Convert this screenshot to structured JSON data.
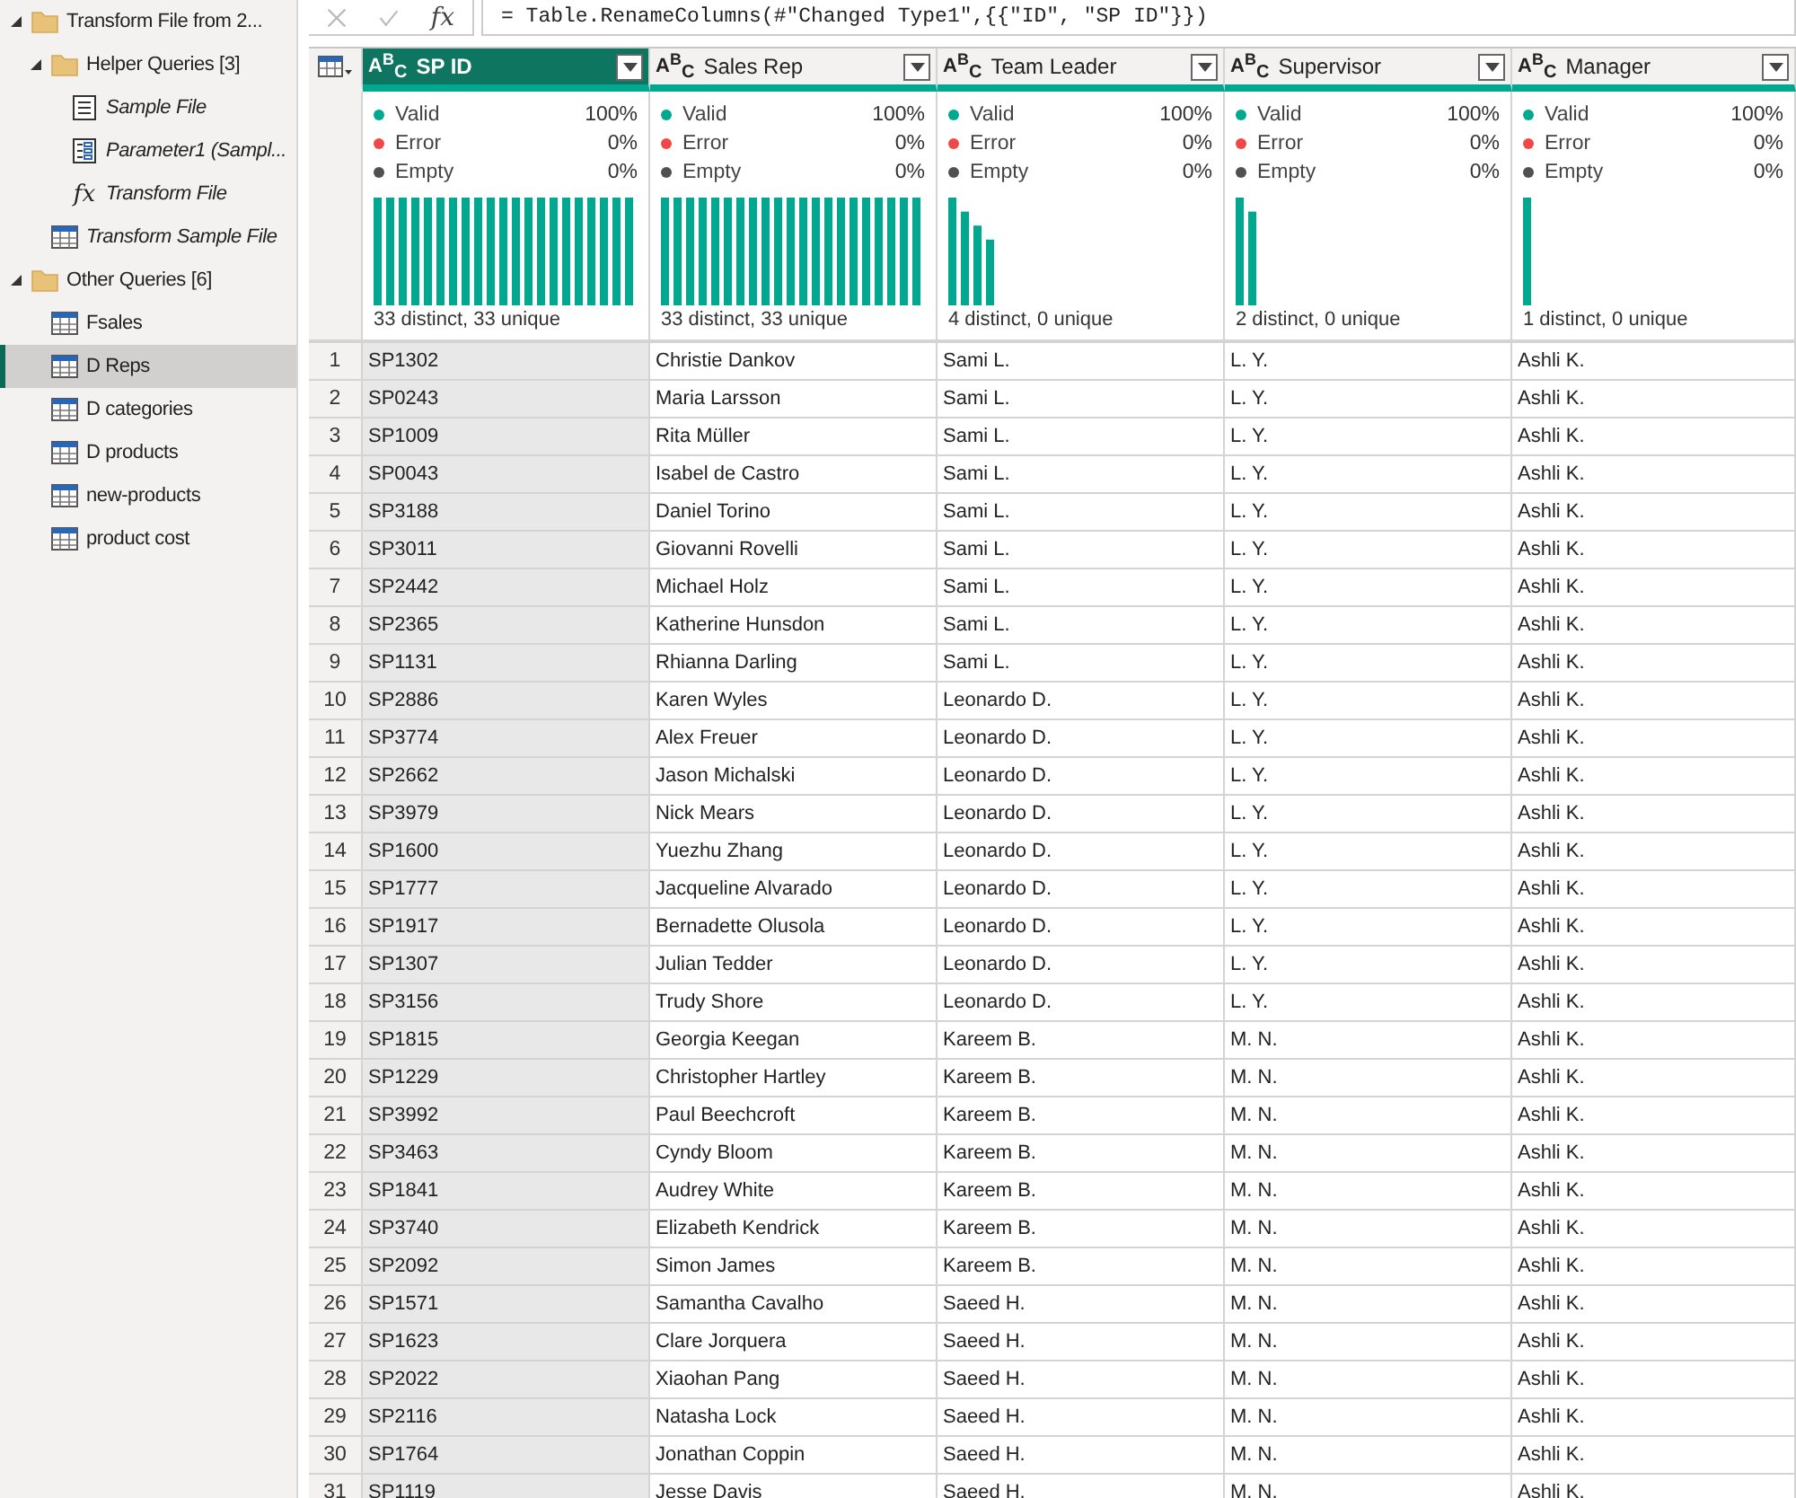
{
  "sidebar": {
    "items": [
      {
        "label": "Transform File from 2...",
        "kind": "folder",
        "expanded": true,
        "load_enabled": true,
        "selected": false,
        "children": [
          {
            "label": "Helper Queries [3]",
            "kind": "folder",
            "expanded": true,
            "load_enabled": true,
            "selected": false,
            "children": [
              {
                "label": "Sample File",
                "kind": "document",
                "load_enabled": false,
                "selected": false
              },
              {
                "label": "Parameter1 (Sampl...",
                "kind": "parameter",
                "load_enabled": false,
                "selected": false
              },
              {
                "label": "Transform File",
                "kind": "function",
                "icon_label": "fx",
                "load_enabled": false,
                "selected": false
              }
            ]
          },
          {
            "label": "Transform Sample File",
            "kind": "table",
            "load_enabled": false,
            "selected": false
          }
        ]
      },
      {
        "label": "Other Queries [6]",
        "kind": "folder",
        "expanded": true,
        "load_enabled": true,
        "selected": false,
        "children": [
          {
            "label": "Fsales",
            "kind": "table",
            "load_enabled": true,
            "selected": false
          },
          {
            "label": "D Reps",
            "kind": "table",
            "load_enabled": true,
            "selected": true
          },
          {
            "label": "D categories",
            "kind": "table",
            "load_enabled": true,
            "selected": false
          },
          {
            "label": "D products",
            "kind": "table",
            "load_enabled": true,
            "selected": false
          },
          {
            "label": "new-products",
            "kind": "table",
            "load_enabled": true,
            "selected": false
          },
          {
            "label": "product cost",
            "kind": "table",
            "load_enabled": true,
            "selected": false
          }
        ]
      }
    ]
  },
  "formula_bar": {
    "fx_label": "fx",
    "formula": "= Table.RenameColumns(#\"Changed Type1\",{{\"ID\", \"SP ID\"}})"
  },
  "table": {
    "columns": [
      {
        "name": "SP ID",
        "type_label": "ABC",
        "selected": true,
        "quality": [
          {
            "label": "Valid",
            "value": "100%",
            "color": "#00a88f"
          },
          {
            "label": "Error",
            "value": "0%",
            "color": "#f04848"
          },
          {
            "label": "Empty",
            "value": "0%",
            "color": "#505050"
          }
        ],
        "distinct": "33 distinct, 33 unique"
      },
      {
        "name": "Sales Rep",
        "type_label": "ABC",
        "selected": false,
        "quality": [
          {
            "label": "Valid",
            "value": "100%",
            "color": "#00a88f"
          },
          {
            "label": "Error",
            "value": "0%",
            "color": "#f04848"
          },
          {
            "label": "Empty",
            "value": "0%",
            "color": "#505050"
          }
        ],
        "distinct": "33 distinct, 33 unique"
      },
      {
        "name": "Team Leader",
        "type_label": "ABC",
        "selected": false,
        "quality": [
          {
            "label": "Valid",
            "value": "100%",
            "color": "#00a88f"
          },
          {
            "label": "Error",
            "value": "0%",
            "color": "#f04848"
          },
          {
            "label": "Empty",
            "value": "0%",
            "color": "#505050"
          }
        ],
        "distinct": "4 distinct, 0 unique"
      },
      {
        "name": "Supervisor",
        "type_label": "ABC",
        "selected": false,
        "quality": [
          {
            "label": "Valid",
            "value": "100%",
            "color": "#00a88f"
          },
          {
            "label": "Error",
            "value": "0%",
            "color": "#f04848"
          },
          {
            "label": "Empty",
            "value": "0%",
            "color": "#505050"
          }
        ],
        "distinct": "2 distinct, 0 unique"
      },
      {
        "name": "Manager",
        "type_label": "ABC",
        "selected": false,
        "quality": [
          {
            "label": "Valid",
            "value": "100%",
            "color": "#00a88f"
          },
          {
            "label": "Error",
            "value": "0%",
            "color": "#f04848"
          },
          {
            "label": "Empty",
            "value": "0%",
            "color": "#505050"
          }
        ],
        "distinct": "1 distinct, 0 unique"
      }
    ],
    "rows": [
      {
        "row_number": "1",
        "cells": [
          "SP1302",
          "Christie Dankov",
          "Sami L.",
          "L. Y.",
          "Ashli K."
        ]
      },
      {
        "row_number": "2",
        "cells": [
          "SP0243",
          "Maria Larsson",
          "Sami L.",
          "L. Y.",
          "Ashli K."
        ]
      },
      {
        "row_number": "3",
        "cells": [
          "SP1009",
          "Rita Müller",
          "Sami L.",
          "L. Y.",
          "Ashli K."
        ]
      },
      {
        "row_number": "4",
        "cells": [
          "SP0043",
          "Isabel de Castro",
          "Sami L.",
          "L. Y.",
          "Ashli K."
        ]
      },
      {
        "row_number": "5",
        "cells": [
          "SP3188",
          "Daniel Torino",
          "Sami L.",
          "L. Y.",
          "Ashli K."
        ]
      },
      {
        "row_number": "6",
        "cells": [
          "SP3011",
          "Giovanni Rovelli",
          "Sami L.",
          "L. Y.",
          "Ashli K."
        ]
      },
      {
        "row_number": "7",
        "cells": [
          "SP2442",
          "Michael Holz",
          "Sami L.",
          "L. Y.",
          "Ashli K."
        ]
      },
      {
        "row_number": "8",
        "cells": [
          "SP2365",
          "Katherine Hunsdon",
          "Sami L.",
          "L. Y.",
          "Ashli K."
        ]
      },
      {
        "row_number": "9",
        "cells": [
          "SP1131",
          "Rhianna Darling",
          "Sami L.",
          "L. Y.",
          "Ashli K."
        ]
      },
      {
        "row_number": "10",
        "cells": [
          "SP2886",
          "Karen Wyles",
          "Leonardo D.",
          "L. Y.",
          "Ashli K."
        ]
      },
      {
        "row_number": "11",
        "cells": [
          "SP3774",
          "Alex Freuer",
          "Leonardo D.",
          "L. Y.",
          "Ashli K."
        ]
      },
      {
        "row_number": "12",
        "cells": [
          "SP2662",
          "Jason Michalski",
          "Leonardo D.",
          "L. Y.",
          "Ashli K."
        ]
      },
      {
        "row_number": "13",
        "cells": [
          "SP3979",
          "Nick Mears",
          "Leonardo D.",
          "L. Y.",
          "Ashli K."
        ]
      },
      {
        "row_number": "14",
        "cells": [
          "SP1600",
          "Yuezhu Zhang",
          "Leonardo D.",
          "L. Y.",
          "Ashli K."
        ]
      },
      {
        "row_number": "15",
        "cells": [
          "SP1777",
          "Jacqueline Alvarado",
          "Leonardo D.",
          "L. Y.",
          "Ashli K."
        ]
      },
      {
        "row_number": "16",
        "cells": [
          "SP1917",
          "Bernadette Olusola",
          "Leonardo D.",
          "L. Y.",
          "Ashli K."
        ]
      },
      {
        "row_number": "17",
        "cells": [
          "SP1307",
          "Julian Tedder",
          "Leonardo D.",
          "L. Y.",
          "Ashli K."
        ]
      },
      {
        "row_number": "18",
        "cells": [
          "SP3156",
          "Trudy Shore",
          "Leonardo D.",
          "L. Y.",
          "Ashli K."
        ]
      },
      {
        "row_number": "19",
        "cells": [
          "SP1815",
          "Georgia Keegan",
          "Kareem B.",
          "M. N.",
          "Ashli K."
        ]
      },
      {
        "row_number": "20",
        "cells": [
          "SP1229",
          "Christopher Hartley",
          "Kareem B.",
          "M. N.",
          "Ashli K."
        ]
      },
      {
        "row_number": "21",
        "cells": [
          "SP3992",
          "Paul Beechcroft",
          "Kareem B.",
          "M. N.",
          "Ashli K."
        ]
      },
      {
        "row_number": "22",
        "cells": [
          "SP3463",
          "Cyndy Bloom",
          "Kareem B.",
          "M. N.",
          "Ashli K."
        ]
      },
      {
        "row_number": "23",
        "cells": [
          "SP1841",
          "Audrey White",
          "Kareem B.",
          "M. N.",
          "Ashli K."
        ]
      },
      {
        "row_number": "24",
        "cells": [
          "SP3740",
          "Elizabeth Kendrick",
          "Kareem B.",
          "M. N.",
          "Ashli K."
        ]
      },
      {
        "row_number": "25",
        "cells": [
          "SP2092",
          "Simon James",
          "Kareem B.",
          "M. N.",
          "Ashli K."
        ]
      },
      {
        "row_number": "26",
        "cells": [
          "SP1571",
          "Samantha Cavalho",
          "Saeed H.",
          "M. N.",
          "Ashli K."
        ]
      },
      {
        "row_number": "27",
        "cells": [
          "SP1623",
          "Clare Jorquera",
          "Saeed H.",
          "M. N.",
          "Ashli K."
        ]
      },
      {
        "row_number": "28",
        "cells": [
          "SP2022",
          "Xiaohan Pang",
          "Saeed H.",
          "M. N.",
          "Ashli K."
        ]
      },
      {
        "row_number": "29",
        "cells": [
          "SP2116",
          "Natasha Lock",
          "Saeed H.",
          "M. N.",
          "Ashli K."
        ]
      },
      {
        "row_number": "30",
        "cells": [
          "SP1764",
          "Jonathan Coppin",
          "Saeed H.",
          "M. N.",
          "Ashli K."
        ]
      },
      {
        "row_number": "31",
        "cells": [
          "SP1119",
          "Jesse Davis",
          "Saeed H.",
          "M. N.",
          "Ashli K."
        ]
      }
    ]
  }
}
